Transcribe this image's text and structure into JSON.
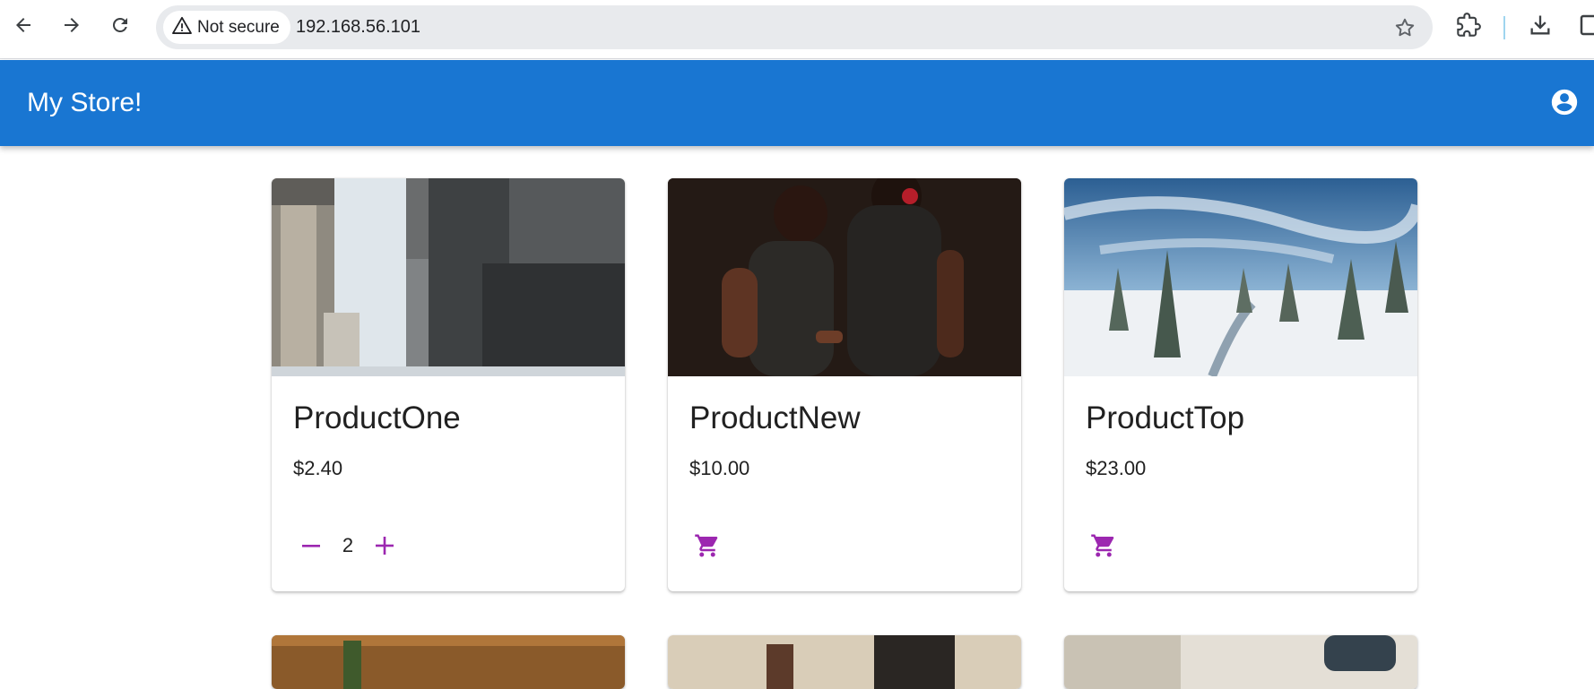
{
  "browser": {
    "security_label": "Not secure",
    "url": "192.168.56.101",
    "icons": [
      "back-arrow-icon",
      "forward-arrow-icon",
      "reload-icon",
      "warning-icon",
      "star-icon",
      "extensions-icon",
      "download-icon",
      "sidebar-icon"
    ]
  },
  "app": {
    "title": "My Store!",
    "brand_color": "#1976d2",
    "accent_color": "#9c27b0",
    "account_icon": "account-circle-icon"
  },
  "products": [
    {
      "name": "ProductOne",
      "price": "$2.40",
      "quantity": "2",
      "image": "city-buildings"
    },
    {
      "name": "ProductNew",
      "price": "$10.00",
      "image": "two-women-dark-portrait"
    },
    {
      "name": "ProductTop",
      "price": "$23.00",
      "image": "snowy-forest-path"
    }
  ],
  "product_icons": {
    "decrement": "minus-icon",
    "increment": "plus-icon",
    "add_to_cart": "cart-icon"
  }
}
